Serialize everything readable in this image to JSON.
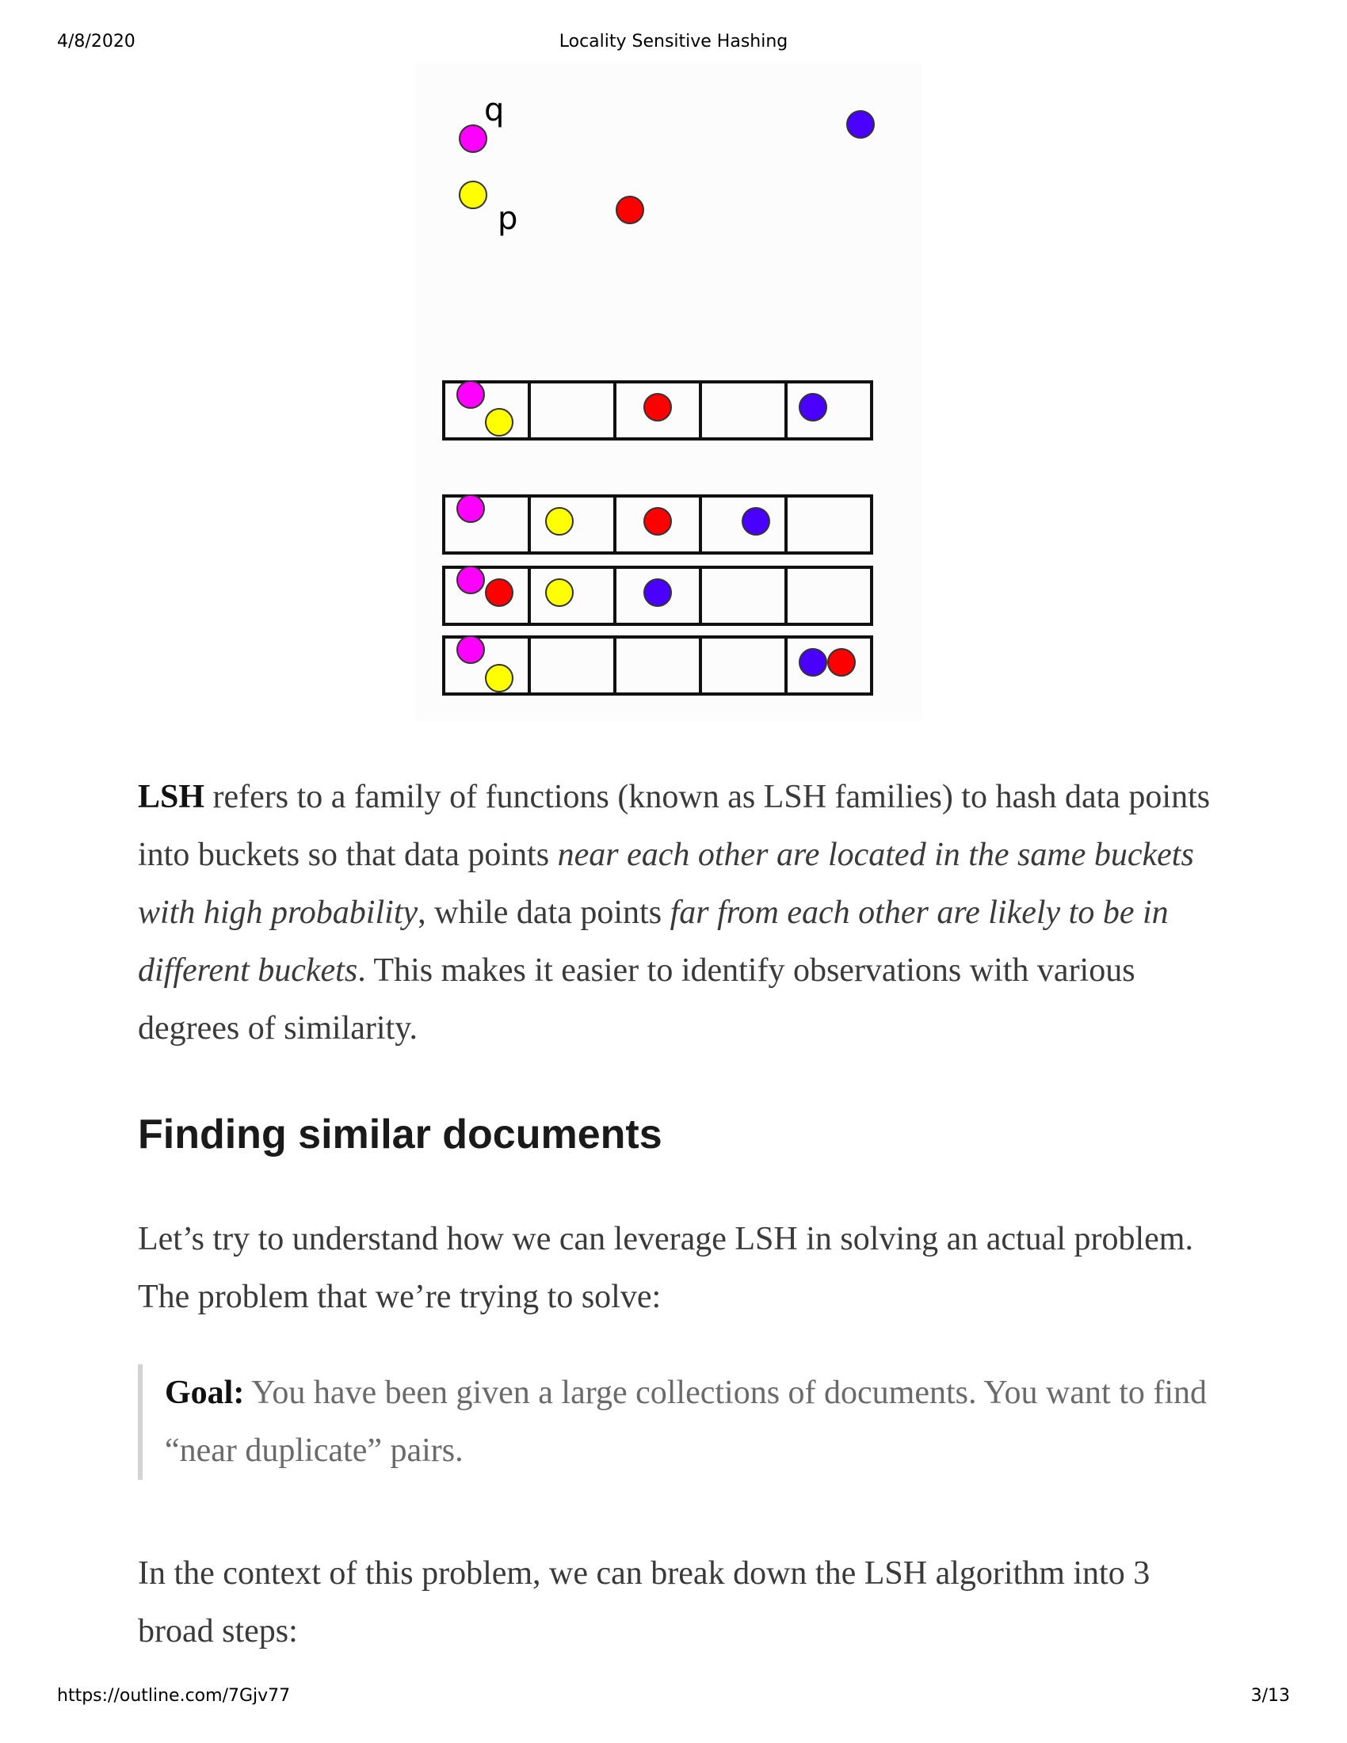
{
  "header": {
    "date": "4/8/2020",
    "title": "Locality Sensitive Hashing"
  },
  "footer": {
    "url": "https://outline.com/7Gjv77",
    "page": "3/13"
  },
  "figure": {
    "label_q": "q",
    "label_p": "p",
    "colors": {
      "magenta": "#ff00ff",
      "yellow": "#ffff00",
      "red": "#ff0000",
      "blue": "#4a00ff"
    }
  },
  "para1": {
    "lsh": "LSH",
    "t1": " refers to a family of functions (known as LSH families) to hash data points into buckets so that data points ",
    "em1": "near each other are located in the same buckets with high probability",
    "t2": ", while data points ",
    "em2": "far from each other are likely to be in different buckets",
    "t3": ". This makes it easier to identify observations with various degrees of similarity."
  },
  "heading": "Finding similar documents",
  "para2": "Let’s try to understand how we can leverage LSH in solving an actual problem. The problem that we’re trying to solve:",
  "quote": {
    "label": "Goal:",
    "text": " You have been given a large collections of documents. You want to find “near duplicate” pairs."
  },
  "para3": "In the context of this problem, we can break down the LSH algorithm into 3 broad steps:"
}
